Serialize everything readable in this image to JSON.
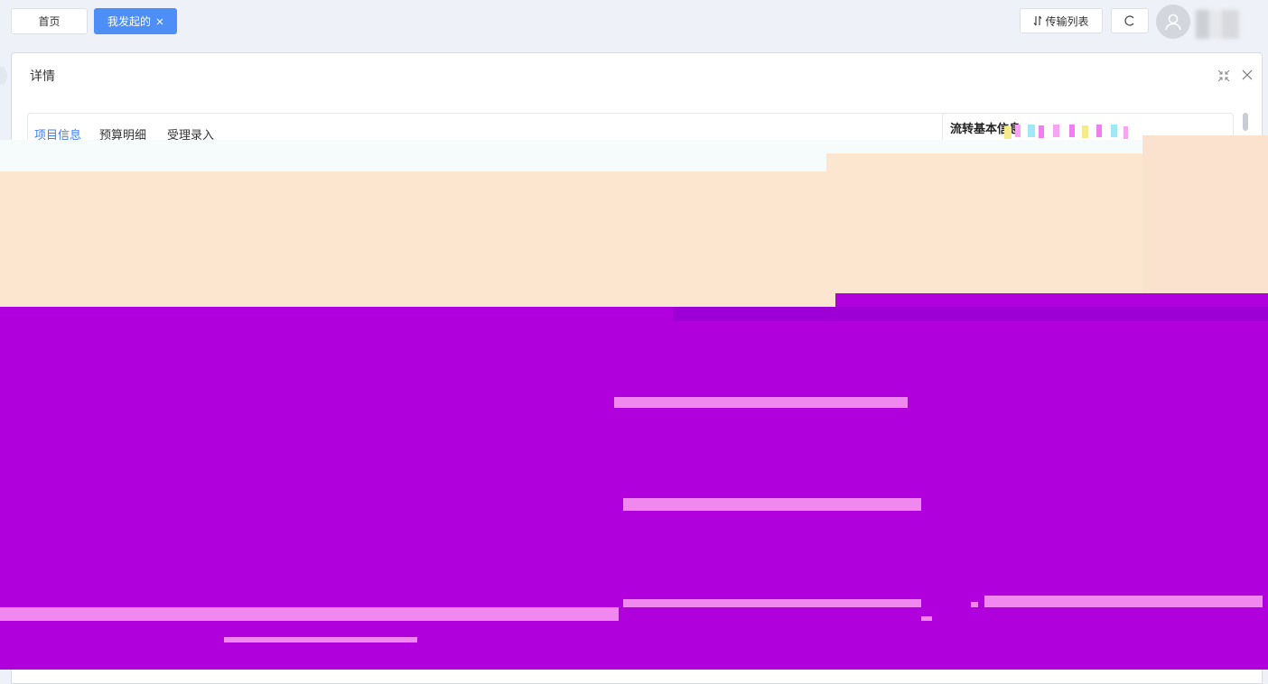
{
  "nav_tabs": [
    {
      "label": "首页",
      "active": false
    },
    {
      "label": "我发起的",
      "active": true,
      "close_icon": "close-icon"
    }
  ],
  "toolbar": {
    "transfer_label": "传输列表",
    "transfer_icon": "transfer-icon",
    "refresh_icon": "refresh-icon",
    "avatar_icon": "user-icon"
  },
  "panel": {
    "title": "详情",
    "collapse_icon": "compress-icon",
    "close_icon": "close-icon"
  },
  "detail_tabs": [
    {
      "label": "项目信息",
      "active": true
    },
    {
      "label": "预算明细",
      "active": false
    },
    {
      "label": "受理录入",
      "active": false
    }
  ],
  "flow_panel": {
    "title": "流转基本信息"
  },
  "colors": {
    "accent": "#3d7ff5",
    "active_tab_bg": "#4d8ff7",
    "corrupt_peach": "#fde6d0",
    "corrupt_purple": "#b000dc",
    "corrupt_pink": "#f088f0"
  }
}
